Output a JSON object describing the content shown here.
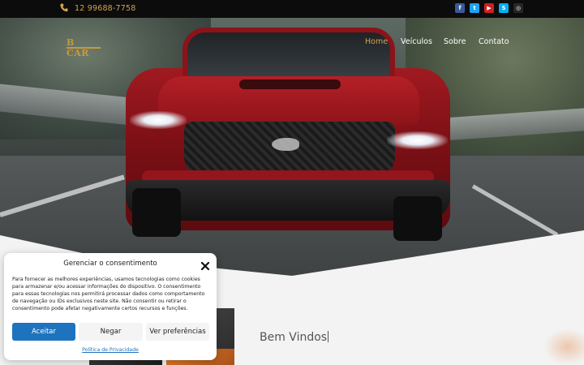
{
  "topbar": {
    "phone": "12 99688-7758",
    "social_icons": [
      {
        "name": "facebook-icon",
        "glyph": "f",
        "color": "#3b5998"
      },
      {
        "name": "twitter-icon",
        "glyph": "t",
        "color": "#1da1f2"
      },
      {
        "name": "youtube-icon",
        "glyph": "▶",
        "color": "#cd201f"
      },
      {
        "name": "skype-icon",
        "glyph": "S",
        "color": "#00aff0"
      },
      {
        "name": "instagram-icon",
        "glyph": "◎",
        "color": "#262626"
      }
    ]
  },
  "brand": {
    "logo_text": "B CAR"
  },
  "nav": {
    "items": [
      {
        "label": "Home",
        "active": true
      },
      {
        "label": "Veículos",
        "active": false
      },
      {
        "label": "Sobre",
        "active": false
      },
      {
        "label": "Contato",
        "active": false
      }
    ]
  },
  "main": {
    "heading": "Bem Vindos"
  },
  "consent": {
    "title": "Gerenciar o consentimento",
    "body": "Para fornecer as melhores experiências, usamos tecnologias como cookies para armazenar e/ou acessar informações do dispositivo. O consentimento para essas tecnologias nos permitirá processar dados como comportamento de navegação ou IDs exclusivos neste site. Não consentir ou retirar o consentimento pode afetar negativamente certos recursos e funções.",
    "accept_label": "Aceitar",
    "deny_label": "Negar",
    "prefs_label": "Ver preferências",
    "privacy_label": "Política de Privacidade"
  },
  "colors": {
    "accent": "#d4a24e",
    "button_primary": "#1e73be"
  }
}
